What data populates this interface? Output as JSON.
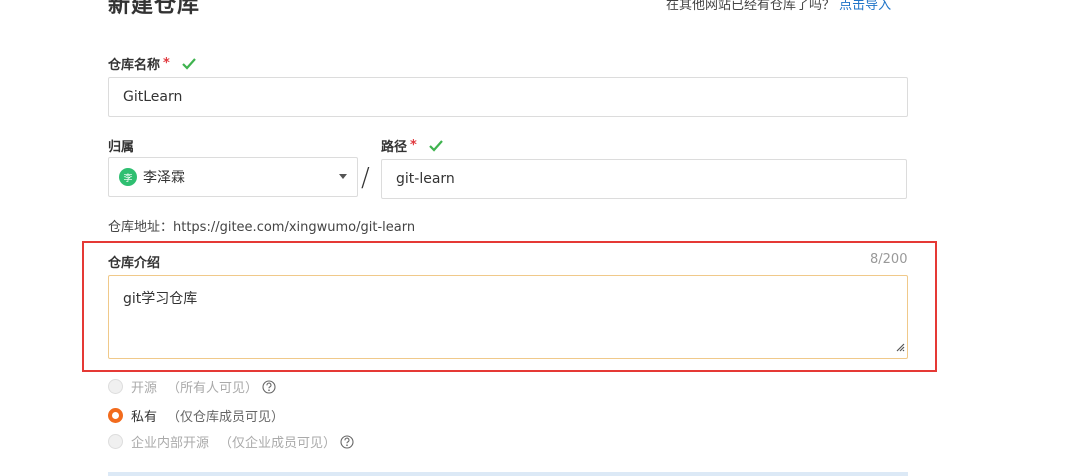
{
  "header": {
    "title": "新建仓库",
    "import_prompt": "在其他网站已经有仓库了吗？",
    "import_link": "点击导入"
  },
  "repo_name": {
    "label": "仓库名称",
    "required_mark": "*",
    "value": "GitLearn"
  },
  "owner": {
    "label": "归属",
    "avatar_text": "李",
    "value": "李泽霖"
  },
  "separator": "/",
  "path": {
    "label": "路径",
    "required_mark": "*",
    "value": "git-learn"
  },
  "repo_address": "仓库地址：https://gitee.com/xingwumo/git-learn",
  "description": {
    "label": "仓库介绍",
    "counter": "8/200",
    "value": "git学习仓库"
  },
  "visibility": {
    "options": [
      {
        "label": "开源",
        "note": "（所有人可见）",
        "selected": false,
        "enabled": false
      },
      {
        "label": "私有",
        "note": "（仅仓库成员可见）",
        "selected": true,
        "enabled": true
      },
      {
        "label": "企业内部开源",
        "note": "（仅企业成员可见）",
        "selected": false,
        "enabled": false
      }
    ]
  },
  "colors": {
    "accent_orange": "#f26b1d",
    "link_blue": "#1f74c8",
    "required_red": "#e0393e",
    "valid_green": "#3fb34f",
    "highlight_red": "#e53935"
  }
}
